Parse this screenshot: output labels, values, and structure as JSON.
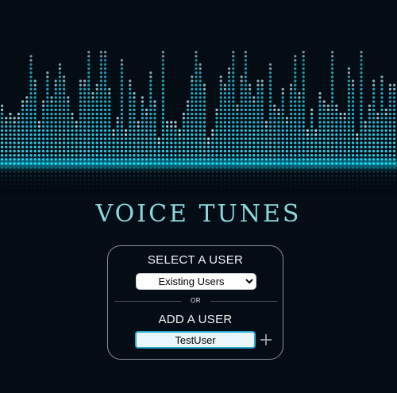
{
  "app": {
    "title": "VOICE TUNES"
  },
  "panel": {
    "select_heading": "SELECT A USER",
    "select": {
      "selected": "Existing Users",
      "options": [
        "Existing Users"
      ]
    },
    "divider_text": "OR",
    "add_heading": "ADD A USER",
    "username_input": {
      "value": "TestUser"
    },
    "add_button_icon": "plus-icon"
  },
  "theme": {
    "background": "#040d15",
    "equalizer_color": "#2fd6f0",
    "title_color": "#8ed6dc",
    "input_border": "#2aa9d2",
    "panel_border": "#8a9298"
  }
}
